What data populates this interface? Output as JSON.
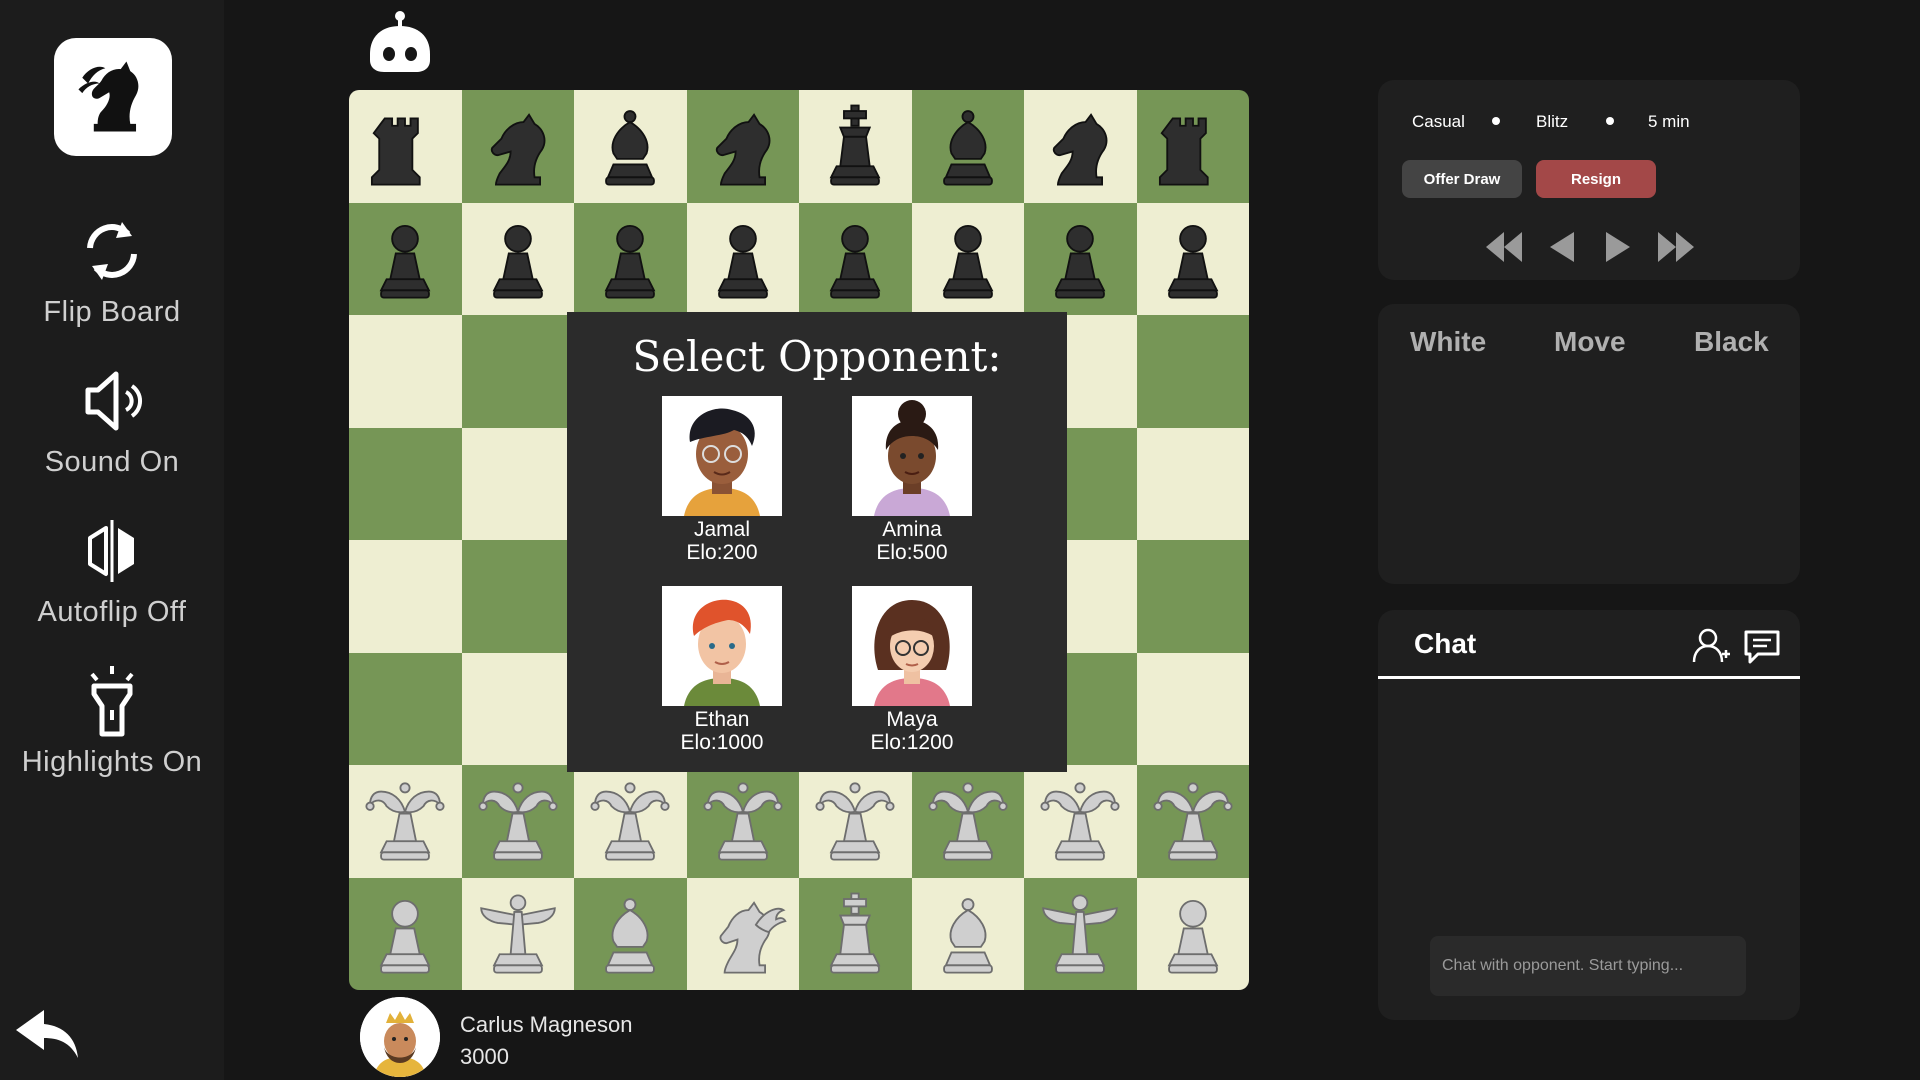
{
  "sidebar": {
    "items": [
      {
        "label": "Flip Board",
        "icon": "flip-icon"
      },
      {
        "label": "Sound On",
        "icon": "speaker-icon"
      },
      {
        "label": "Autoflip Off",
        "icon": "autoflip-icon"
      },
      {
        "label": "Highlights On",
        "icon": "flashlight-icon"
      }
    ],
    "back_icon": "back-arrow-icon",
    "logo_icon": "chess-knight-logo-icon"
  },
  "top": {
    "opponent_icon": "robot-icon"
  },
  "board": {
    "light_color": "#eeeed2",
    "dark_color": "#769656",
    "rows": [
      [
        "black-rook",
        "black-knight",
        "black-bishop",
        "black-knight",
        "black-king",
        "black-bishop",
        "black-knight",
        "black-rook"
      ],
      [
        "black-pawn",
        "black-pawn",
        "black-pawn",
        "black-pawn",
        "black-pawn",
        "black-pawn",
        "black-pawn",
        "black-pawn"
      ],
      [
        "",
        "",
        "",
        "",
        "",
        "",
        "",
        ""
      ],
      [
        "",
        "",
        "",
        "",
        "",
        "",
        "",
        ""
      ],
      [
        "",
        "",
        "",
        "",
        "",
        "",
        "",
        ""
      ],
      [
        "",
        "",
        "",
        "",
        "",
        "",
        "",
        ""
      ],
      [
        "white-jester",
        "white-jester",
        "white-jester",
        "white-jester",
        "white-jester",
        "white-jester",
        "white-jester",
        "white-jester"
      ],
      [
        "white-pawn",
        "white-fairy",
        "white-bishop",
        "white-pegasus",
        "white-king",
        "white-bishop",
        "white-fairy",
        "white-pawn"
      ]
    ]
  },
  "select_opponent": {
    "title": "Select Opponent:",
    "opponents": [
      {
        "name": "Jamal",
        "elo": "Elo:200"
      },
      {
        "name": "Amina",
        "elo": "Elo:500"
      },
      {
        "name": "Ethan",
        "elo": "Elo:1000"
      },
      {
        "name": "Maya",
        "elo": "Elo:1200"
      }
    ]
  },
  "player": {
    "name": "Carlus Magneson",
    "rating": "3000"
  },
  "game_info": {
    "mode": "Casual",
    "speed": "Blitz",
    "time": "5 min",
    "offer_draw": "Offer Draw",
    "resign": "Resign",
    "resign_color": "#a34848"
  },
  "moves": {
    "col_white": "White",
    "col_move": "Move",
    "col_black": "Black"
  },
  "chat": {
    "title": "Chat",
    "placeholder": "Chat with opponent. Start typing...",
    "add_friend_icon": "add-user-icon",
    "chat_icon": "chat-bubble-icon"
  }
}
